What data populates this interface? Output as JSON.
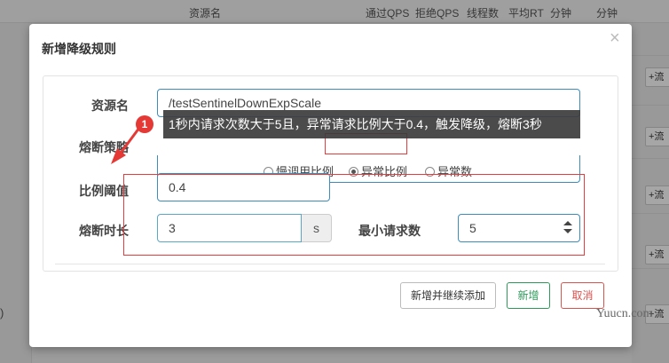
{
  "background": {
    "header": {
      "col1": "资源名",
      "col2": "通过QPS",
      "col3": "拒绝QPS",
      "col4": "线程数",
      "col5": "平均RT",
      "col6": "分钟",
      "col7": "分钟"
    },
    "add_button_label": "+流",
    "left_stub": ")"
  },
  "modal": {
    "title": "新增降级规则",
    "close_glyph": "×",
    "resource": {
      "label": "资源名",
      "value": "/testSentinelDownExpScale"
    },
    "strategy": {
      "label": "熔断策略",
      "options": [
        "慢调用比例",
        "异常比例",
        "异常数"
      ],
      "selected": "异常比例"
    },
    "ratio": {
      "label": "比例阈值",
      "value": "0.4"
    },
    "duration": {
      "label": "熔断时长",
      "value": "3",
      "unit": "s"
    },
    "min_requests": {
      "label": "最小请求数",
      "value": "5"
    },
    "buttons": {
      "continue": "新增并继续添加",
      "add": "新增",
      "cancel": "取消"
    }
  },
  "annotation": {
    "badge": "1",
    "tooltip": "1秒内请求次数大于5且，异常请求比例大于0.4，触发降级，熔断3秒",
    "watermark": "Yuucn.com"
  },
  "colors": {
    "primary_border": "#3d8dbc",
    "add": "#2e9a5a",
    "cancel": "#d9534f",
    "annotation_red": "#e83b3b"
  }
}
